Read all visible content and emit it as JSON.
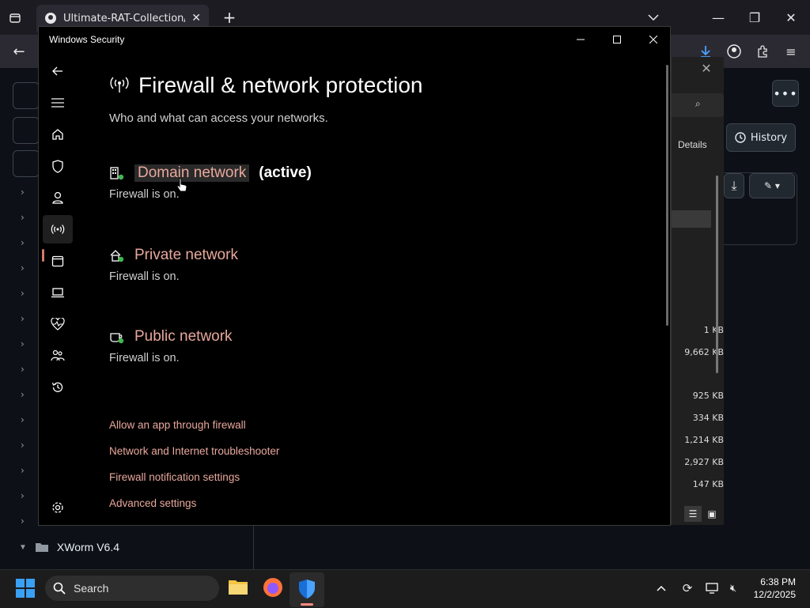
{
  "browser": {
    "tab_title": "Ultimate-RAT-Collection/XWorm",
    "history_label": "History",
    "details_label": "Details"
  },
  "tree": {
    "folder_label": "XWorm V6.4"
  },
  "file_sizes": [
    "1 KB",
    "9,662 KB",
    "925 KB",
    "334 KB",
    "1,214 KB",
    "2,927 KB",
    "147 KB"
  ],
  "window": {
    "title": "Windows Security"
  },
  "page": {
    "heading": "Firewall & network protection",
    "subtitle": "Who and what can access your networks."
  },
  "networks": [
    {
      "name": "Domain network",
      "active": "(active)",
      "status": "Firewall is on.",
      "icon": "domain-network-icon"
    },
    {
      "name": "Private network",
      "active": "",
      "status": "Firewall is on.",
      "icon": "private-network-icon"
    },
    {
      "name": "Public network",
      "active": "",
      "status": "Firewall is on.",
      "icon": "public-network-icon"
    }
  ],
  "links": [
    "Allow an app through firewall",
    "Network and Internet troubleshooter",
    "Firewall notification settings",
    "Advanced settings"
  ],
  "nav_items": [
    "back-icon",
    "menu-icon",
    "home-icon",
    "shield-icon",
    "account-icon",
    "firewall-icon",
    "app-browser-icon",
    "device-security-icon",
    "health-icon",
    "family-icon",
    "history-icon",
    "settings-icon"
  ],
  "taskbar": {
    "search_placeholder": "Search",
    "time": "6:38 PM",
    "date": "12/2/2025"
  },
  "colors": {
    "accent": "#e8a89c",
    "selection_bar": "#d4786a",
    "status_ok": "#3fb950"
  }
}
